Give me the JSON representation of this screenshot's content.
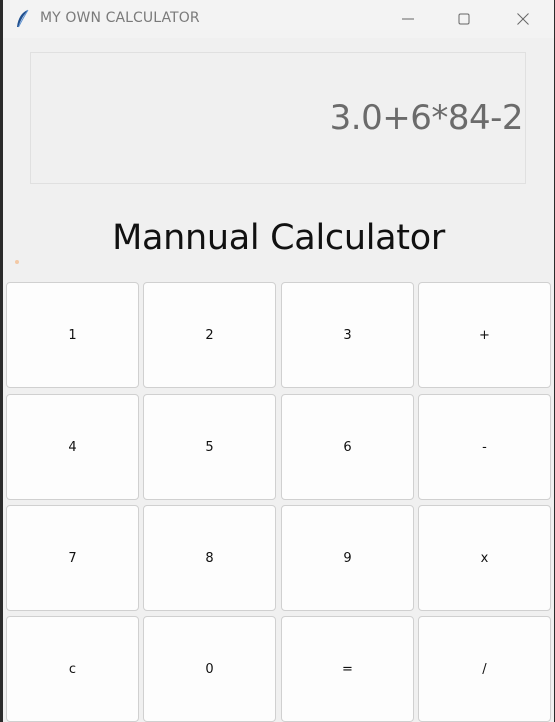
{
  "window": {
    "title": "MY OWN CALCULATOR",
    "app_icon": "feather-icon",
    "controls": [
      "minimize-icon",
      "maximize-icon",
      "close-icon"
    ]
  },
  "display": {
    "expression": "3.0+6*84-2"
  },
  "heading": "Mannual Calculator",
  "keypad": {
    "rows": [
      [
        "1",
        "2",
        "3",
        "+"
      ],
      [
        "4",
        "5",
        "6",
        "-"
      ],
      [
        "7",
        "8",
        "9",
        "x"
      ],
      [
        "c",
        "0",
        "=",
        "/"
      ]
    ]
  },
  "colors": {
    "window_background": "#f0f0f0",
    "button_background": "#fdfdfd",
    "button_border": "#d0d0d0",
    "display_text": "#6b6b6b"
  }
}
